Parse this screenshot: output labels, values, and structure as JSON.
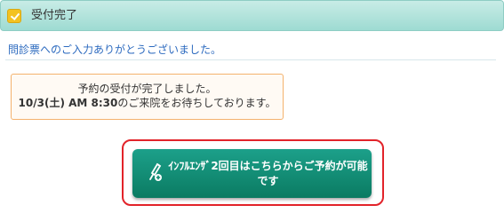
{
  "header": {
    "title": "受付完了",
    "icon": "checkbox-icon"
  },
  "message": "問診票へのご入力ありがとうございました。",
  "notice": {
    "line1": "予約の受付が完了しました。",
    "date": "10/3(土) AM 8:30",
    "line2_rest": "のご来院をお待ちしております。"
  },
  "reserve_button": {
    "label": "ｲﾝﾌﾙｴﾝｻﾞ2回目はこちらからご予約が可能です",
    "icon": "syringe-icon"
  },
  "colors": {
    "header_bg": "#a9dfd7",
    "message_text": "#2c6abf",
    "notice_border": "#f4b26d",
    "button_bg": "#12907a",
    "highlight_border": "#e2232a"
  }
}
